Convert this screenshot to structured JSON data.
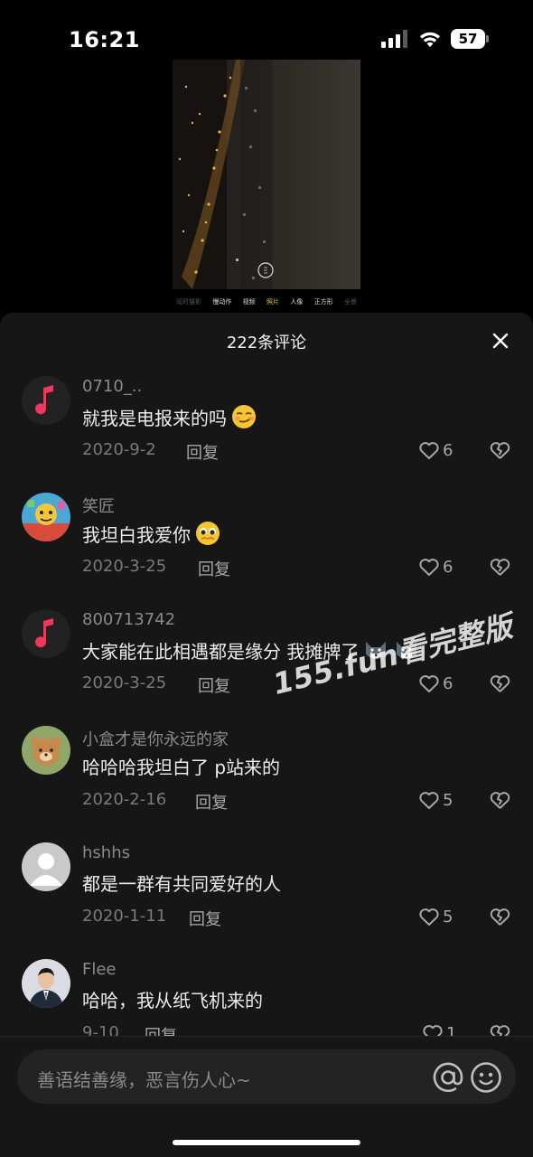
{
  "status_bar": {
    "time": "16:21",
    "battery": "57"
  },
  "camera": {
    "modes": [
      "延时摄影",
      "慢动作",
      "视频",
      "照片",
      "人像",
      "正方形",
      "全景"
    ],
    "active_mode": "照片"
  },
  "sheet": {
    "title": "222条评论"
  },
  "comments": [
    {
      "name": "0710_..",
      "text": "就我是电报来的吗",
      "emoji": "smirk-emoji",
      "date": "2020-9-2",
      "reply": "回复",
      "likes": "6",
      "avatar": "music-app-avatar"
    },
    {
      "name": "笑匠",
      "text": "我坦白我爱你",
      "emoji": "pleading-emoji",
      "date": "2020-3-25",
      "reply": "回复",
      "likes": "6",
      "avatar": "cartoon-avatar"
    },
    {
      "name": "800713742",
      "text": "大家能在此相遇都是缘分 我摊牌了",
      "emoji": "wolf-emoji",
      "date": "2020-3-25",
      "reply": "回复",
      "likes": "6",
      "avatar": "music-app-avatar"
    },
    {
      "name": "小盒才是你永远的家",
      "text": "哈哈哈我坦白了 p站来的",
      "emoji": "",
      "date": "2020-2-16",
      "reply": "回复",
      "likes": "5",
      "avatar": "bear-avatar"
    },
    {
      "name": "hshhs",
      "text": "都是一群有共同爱好的人",
      "emoji": "",
      "date": "2020-1-11",
      "reply": "回复",
      "likes": "5",
      "avatar": "default-avatar"
    },
    {
      "name": "Flee",
      "text": "哈哈，我从纸飞机来的",
      "emoji": "",
      "date": "9-10",
      "reply": "回复",
      "likes": "1",
      "avatar": "man-in-suit-avatar"
    }
  ],
  "watermark": "155.fun看完整版",
  "input": {
    "placeholder": "善语结善缘，恶言伤人心~"
  },
  "colors": {
    "background": "#000000",
    "sheet": "#161616",
    "music_red": "#f3365a",
    "camera_active": "#f2c12e"
  }
}
